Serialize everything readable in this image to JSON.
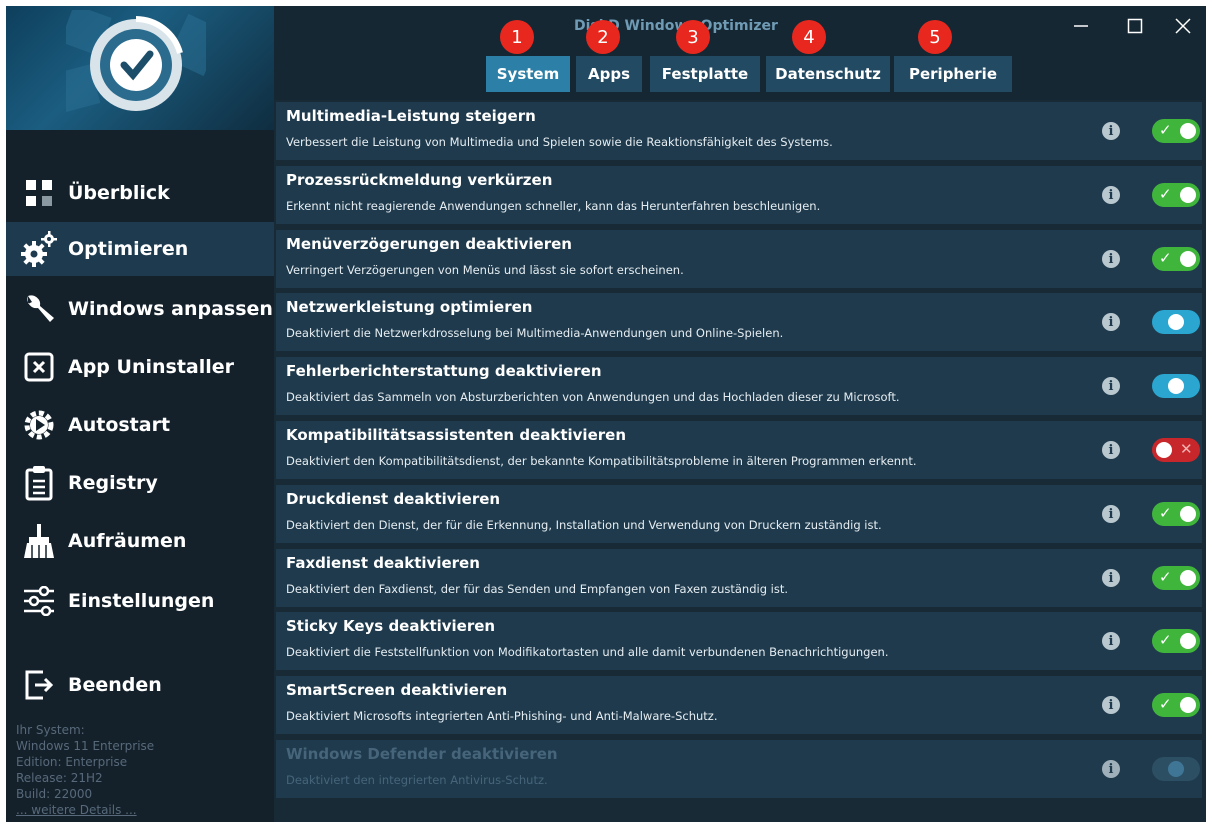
{
  "window": {
    "title": "DiskD Windows Optimizer"
  },
  "sidebar": {
    "items": [
      {
        "label": "Überblick"
      },
      {
        "label": "Optimieren"
      },
      {
        "label": "Windows anpassen"
      },
      {
        "label": "App Uninstaller"
      },
      {
        "label": "Autostart"
      },
      {
        "label": "Registry"
      },
      {
        "label": "Aufräumen"
      },
      {
        "label": "Einstellungen"
      },
      {
        "label": "Beenden"
      }
    ],
    "active_index": 1
  },
  "system_info": {
    "heading": "Ihr System:",
    "os": "Windows 11 Enterprise",
    "edition": "Edition: Enterprise",
    "release": "Release: 21H2",
    "build": "Build: 22000",
    "details_link": "... weitere Details ..."
  },
  "tabs": [
    {
      "label": "System",
      "badge": "1"
    },
    {
      "label": "Apps",
      "badge": "2"
    },
    {
      "label": "Festplatte",
      "badge": "3"
    },
    {
      "label": "Datenschutz",
      "badge": "4"
    },
    {
      "label": "Peripherie",
      "badge": "5"
    }
  ],
  "active_tab": "System",
  "info_badge": "6",
  "tweaks": [
    {
      "title": "Multimedia-Leistung steigern",
      "description": "Verbessert die Leistung von Multimedia und Spielen sowie die Reaktionsfähigkeit des Systems.",
      "state": "on"
    },
    {
      "title": "Prozessrückmeldung verkürzen",
      "description": "Erkennt nicht reagierende Anwendungen schneller, kann das Herunterfahren beschleunigen.",
      "state": "on"
    },
    {
      "title": "Menüverzögerungen deaktivieren",
      "description": "Verringert Verzögerungen von Menüs und lässt sie sofort erscheinen.",
      "state": "on"
    },
    {
      "title": "Netzwerkleistung optimieren",
      "description": "Deaktiviert die Netzwerkdrosselung bei Multimedia-Anwendungen und Online-Spielen.",
      "state": "mid"
    },
    {
      "title": "Fehlerberichterstattung deaktivieren",
      "description": "Deaktiviert das Sammeln von Absturzberichten von Anwendungen und das Hochladen dieser zu Microsoft.",
      "state": "mid"
    },
    {
      "title": "Kompatibilitätsassistenten deaktivieren",
      "description": "Deaktiviert den Kompatibilitätsdienst, der bekannte Kompatibilitätsprobleme in älteren Programmen erkennt.",
      "state": "off"
    },
    {
      "title": "Druckdienst deaktivieren",
      "description": "Deaktiviert den Dienst, der für die Erkennung, Installation und Verwendung von Druckern zuständig ist.",
      "state": "on"
    },
    {
      "title": "Faxdienst deaktivieren",
      "description": "Deaktiviert den Faxdienst, der für das Senden und Empfangen von Faxen zuständig ist.",
      "state": "on"
    },
    {
      "title": "Sticky Keys deaktivieren",
      "description": "Deaktiviert die Feststellfunktion von Modifikatortasten und alle damit verbundenen Benachrichtigungen.",
      "state": "on"
    },
    {
      "title": "SmartScreen deaktivieren",
      "description": "Deaktiviert Microsofts integrierten Anti-Phishing- und Anti-Malware-Schutz.",
      "state": "on"
    },
    {
      "title": "Windows Defender deaktivieren",
      "description": "Deaktiviert den integrierten Antivirus-Schutz.",
      "state": "disabled"
    }
  ],
  "colors": {
    "accent": "#2c7fa6",
    "toggle_on": "#40b53b",
    "toggle_mid": "#2aa6d0",
    "toggle_off": "#c7272b",
    "badge": "#e8281e"
  }
}
